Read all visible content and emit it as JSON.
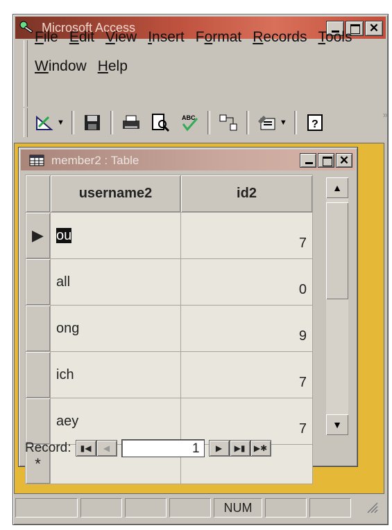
{
  "app": {
    "title": "Microsoft Access",
    "menus_row1": [
      {
        "label": "File",
        "key": "F",
        "rest": "ile"
      },
      {
        "label": "Edit",
        "key": "E",
        "rest": "dit"
      },
      {
        "label": "View",
        "key": "V",
        "rest": "iew"
      },
      {
        "label": "Insert",
        "key": "I",
        "rest": "nsert"
      },
      {
        "label": "Format",
        "pre": "F",
        "key": "o",
        "rest": "rmat"
      },
      {
        "label": "Records",
        "key": "R",
        "rest": "ecords"
      },
      {
        "label": "Tools",
        "key": "T",
        "rest": "ools"
      }
    ],
    "menus_row2": [
      {
        "label": "Window",
        "key": "W",
        "rest": "indow"
      },
      {
        "label": "Help",
        "key": "H",
        "rest": "elp"
      }
    ],
    "toolbar_icons": [
      "design-view-icon",
      "save-icon",
      "print-icon",
      "print-preview-icon",
      "spelling-icon",
      "relationships-icon",
      "new-object-icon",
      "help-icon"
    ]
  },
  "child_window": {
    "title": "member2 : Table",
    "columns": [
      "username2",
      "id2"
    ],
    "rows": [
      {
        "username2": "ou",
        "id2": "7"
      },
      {
        "username2": "all",
        "id2": "0"
      },
      {
        "username2": "ong",
        "id2": "9"
      },
      {
        "username2": "ich",
        "id2": "7"
      },
      {
        "username2": "aey",
        "id2": "7"
      }
    ],
    "new_row_marker": "*",
    "current_row_marker": "▶"
  },
  "navigation": {
    "label": "Record:",
    "current": "1"
  },
  "status": {
    "num": "NUM"
  },
  "colors": {
    "title_active": "#c0533f",
    "mdi_background": "#e5b937",
    "face": "#c7c3bb"
  }
}
